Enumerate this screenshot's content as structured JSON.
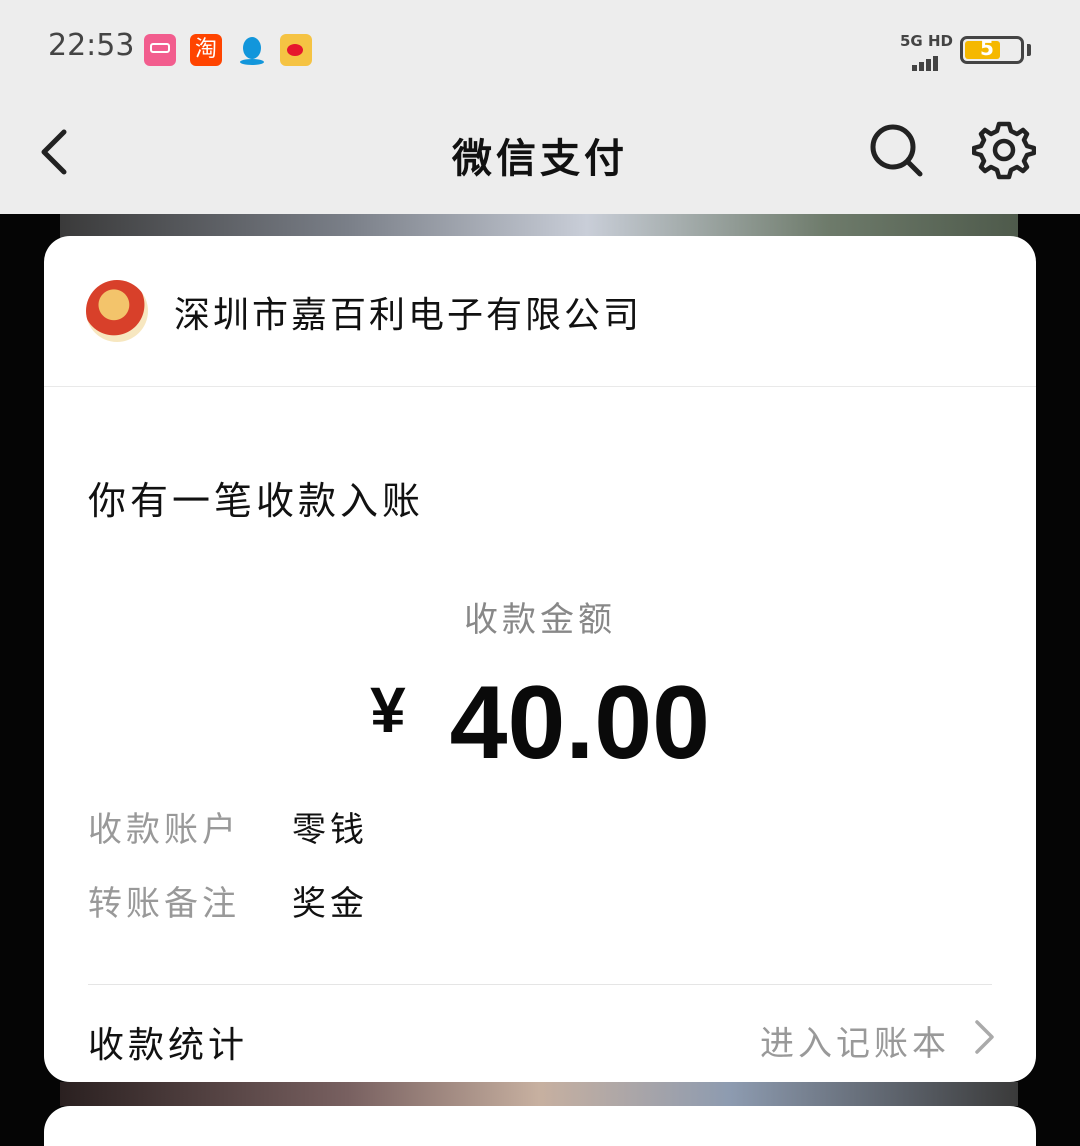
{
  "status_bar": {
    "time": "22:53",
    "network": "5G HD",
    "battery": "5",
    "notifications": [
      "bilibili-icon",
      "taobao-icon",
      "qq-icon",
      "weibo-icon"
    ],
    "taobao_glyph": "淘"
  },
  "nav": {
    "title": "微信支付"
  },
  "card": {
    "company": "深圳市嘉百利电子有限公司",
    "headline": "你有一笔收款入账",
    "amount_label": "收款金额",
    "currency": "¥",
    "amount": "40.00",
    "account_label": "收款账户",
    "account_value": "零钱",
    "remark_label": "转账备注",
    "remark_value": "奖金",
    "stats_label": "收款统计",
    "ledger_link": "进入记账本"
  },
  "colors": {
    "nav_bg": "#ededed",
    "card_bg": "#ffffff",
    "muted_text": "#999999",
    "battery": "#f5b800"
  }
}
